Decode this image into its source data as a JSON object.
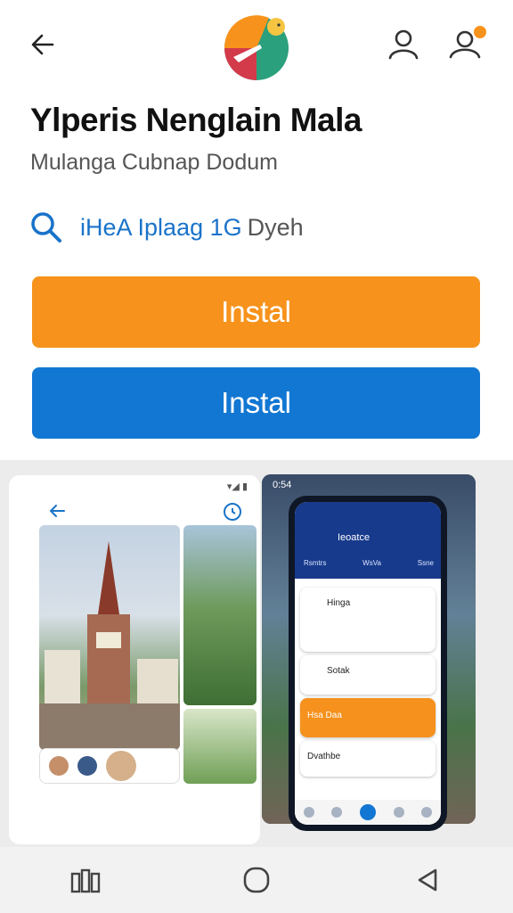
{
  "header": {
    "back_icon": "arrow-left-icon",
    "logo_icon": "app-logo-icon",
    "profile_icon": "person-icon",
    "account_icon": "person-notification-icon",
    "badge_color": "#f7931c"
  },
  "app": {
    "title": "Ylperis Nenglain Mala",
    "subtitle": "Mulanga Cubnap Dodum"
  },
  "search_row": {
    "icon": "search-icon",
    "link_text": "iHeA Iplaag 1G",
    "rest_text": "Dyeh"
  },
  "buttons": {
    "primary_label": "Instal",
    "secondary_label": "Instal",
    "primary_color": "#f7931c",
    "secondary_color": "#1277d3"
  },
  "screenshots": {
    "phone_status_time": "0:54",
    "phone_header_title": "Ieoatce",
    "phone_tabs": [
      "Rsmtrs",
      "WsVa",
      "Ssne"
    ],
    "card_title": "Hinga",
    "card2_title": "Sotak",
    "card3_title": "Hsa Daa",
    "card4_title": "Dvathbe"
  },
  "system_nav": {
    "recents_icon": "recents-icon",
    "home_icon": "home-circle-icon",
    "back_icon": "triangle-back-icon"
  }
}
